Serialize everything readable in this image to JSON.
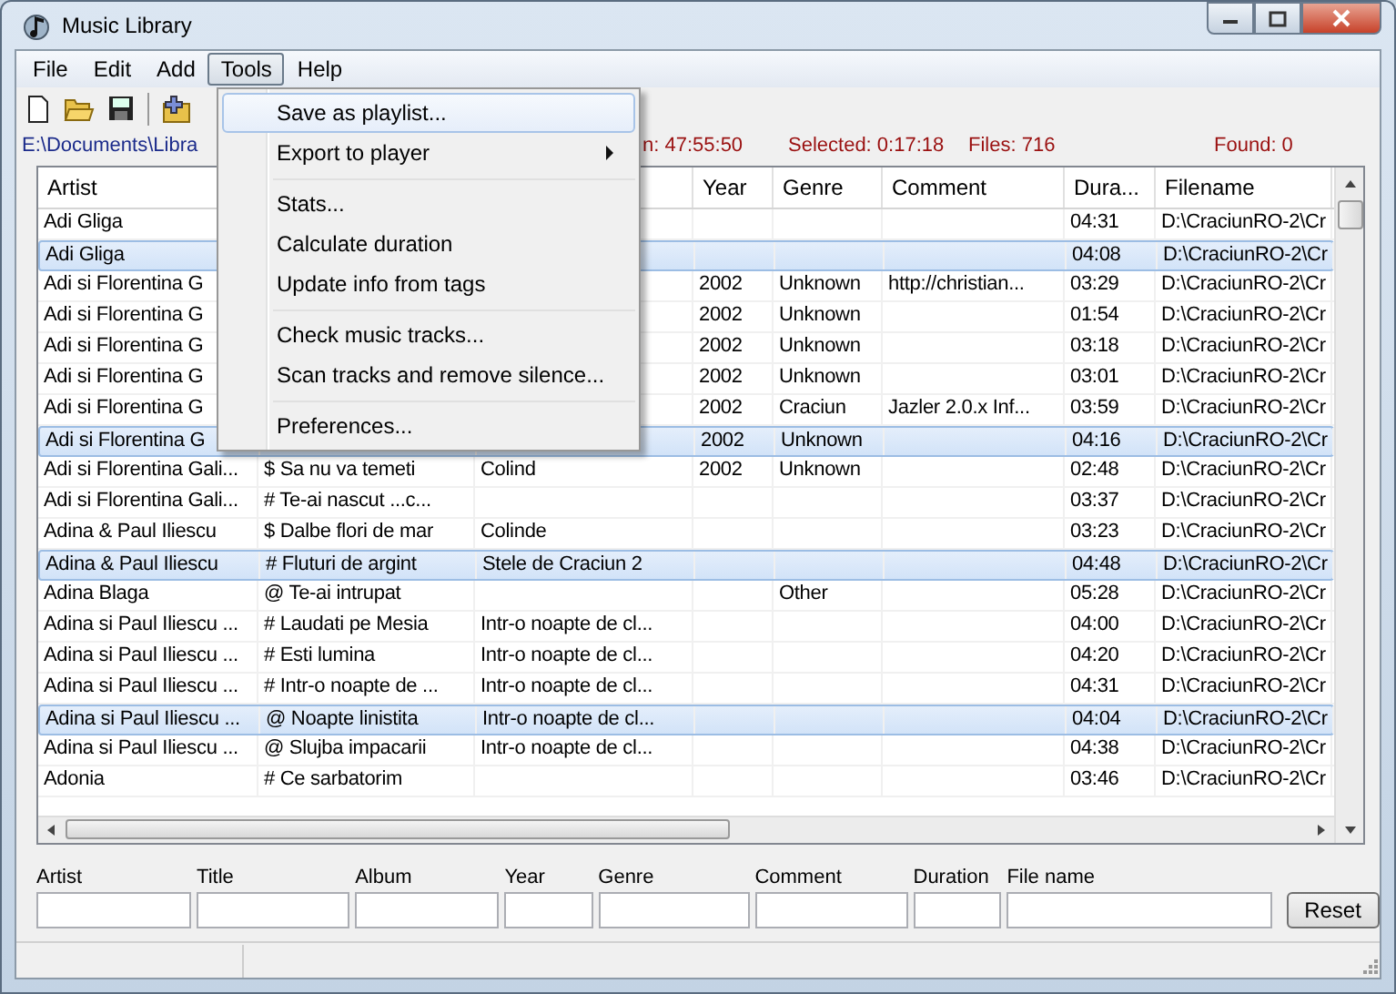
{
  "window": {
    "title": "Music Library"
  },
  "menubar": [
    {
      "label": "File",
      "selected": false
    },
    {
      "label": "Edit",
      "selected": false
    },
    {
      "label": "Add",
      "selected": false
    },
    {
      "label": "Tools",
      "selected": true
    },
    {
      "label": "Help",
      "selected": false
    }
  ],
  "menu": {
    "groups": [
      [
        {
          "label": "Save as playlist...",
          "selected": true,
          "submenu": false
        },
        {
          "label": "Export to player",
          "selected": false,
          "submenu": true
        }
      ],
      [
        {
          "label": "Stats...",
          "selected": false,
          "submenu": false
        },
        {
          "label": "Calculate duration",
          "selected": false,
          "submenu": false
        },
        {
          "label": "Update info from tags",
          "selected": false,
          "submenu": false
        }
      ],
      [
        {
          "label": "Check music tracks...",
          "selected": false,
          "submenu": false
        },
        {
          "label": "Scan tracks and remove silence...",
          "selected": false,
          "submenu": false
        }
      ],
      [
        {
          "label": "Preferences...",
          "selected": false,
          "submenu": false
        }
      ]
    ]
  },
  "info": {
    "path": "E:\\Documents\\Libra",
    "duration": "n: 47:55:50",
    "selected": "Selected: 0:17:18",
    "files": "Files: 716",
    "found": "Found: 0"
  },
  "table": {
    "columns": {
      "artist": "Artist",
      "year": "Year",
      "genre": "Genre",
      "comment": "Comment",
      "duration": "Dura...",
      "filename": "Filename"
    },
    "rows": [
      {
        "artist": "Adi Gliga",
        "duration": "04:31",
        "filename": "D:\\CraciunRO-2\\Cr",
        "selected": false
      },
      {
        "artist": "Adi Gliga",
        "duration": "04:08",
        "filename": "D:\\CraciunRO-2\\Cr",
        "selected": true
      },
      {
        "artist": "Adi si Florentina G",
        "year": "2002",
        "genre": "Unknown",
        "comment": "http://christian...",
        "duration": "03:29",
        "filename": "D:\\CraciunRO-2\\Cr",
        "selected": false
      },
      {
        "artist": "Adi si Florentina G",
        "year": "2002",
        "genre": "Unknown",
        "duration": "01:54",
        "filename": "D:\\CraciunRO-2\\Cr",
        "selected": false
      },
      {
        "artist": "Adi si Florentina G",
        "year": "2002",
        "genre": "Unknown",
        "duration": "03:18",
        "filename": "D:\\CraciunRO-2\\Cr",
        "selected": false
      },
      {
        "artist": "Adi si Florentina G",
        "year": "2002",
        "genre": "Unknown",
        "duration": "03:01",
        "filename": "D:\\CraciunRO-2\\Cr",
        "selected": false
      },
      {
        "artist": "Adi si Florentina G",
        "year": "2002",
        "genre": "Craciun",
        "comment": "Jazler 2.0.x Inf...",
        "duration": "03:59",
        "filename": "D:\\CraciunRO-2\\Cr",
        "selected": false
      },
      {
        "artist": "Adi si Florentina G",
        "year": "2002",
        "genre": "Unknown",
        "duration": "04:16",
        "filename": "D:\\CraciunRO-2\\Cr",
        "selected": true
      },
      {
        "artist": "Adi si Florentina Gali...",
        "title": "$ Sa nu va temeti",
        "album": "Colind",
        "year": "2002",
        "genre": "Unknown",
        "duration": "02:48",
        "filename": "D:\\CraciunRO-2\\Cr",
        "selected": false
      },
      {
        "artist": "Adi si Florentina Gali...",
        "title": "# Te-ai nascut ...c...",
        "duration": "03:37",
        "filename": "D:\\CraciunRO-2\\Cr",
        "selected": false
      },
      {
        "artist": "Adina & Paul Iliescu",
        "title": "$ Dalbe flori de mar",
        "album": "Colinde",
        "duration": "03:23",
        "filename": "D:\\CraciunRO-2\\Cr",
        "selected": false
      },
      {
        "artist": "Adina & Paul Iliescu",
        "title": "# Fluturi de argint",
        "album": "Stele de Craciun 2",
        "duration": "04:48",
        "filename": "D:\\CraciunRO-2\\Cr",
        "selected": true
      },
      {
        "artist": "Adina Blaga",
        "title": "@ Te-ai intrupat",
        "genre": "Other",
        "duration": "05:28",
        "filename": "D:\\CraciunRO-2\\Cr",
        "selected": false
      },
      {
        "artist": "Adina si Paul Iliescu ...",
        "title": "# Laudati pe Mesia",
        "album": "Intr-o noapte de cl...",
        "duration": "04:00",
        "filename": "D:\\CraciunRO-2\\Cr",
        "selected": false
      },
      {
        "artist": "Adina si Paul Iliescu ...",
        "title": "# Esti lumina",
        "album": "Intr-o noapte de cl...",
        "duration": "04:20",
        "filename": "D:\\CraciunRO-2\\Cr",
        "selected": false
      },
      {
        "artist": "Adina si Paul Iliescu ...",
        "title": "# Intr-o noapte de ...",
        "album": "Intr-o noapte de cl...",
        "duration": "04:31",
        "filename": "D:\\CraciunRO-2\\Cr",
        "selected": false
      },
      {
        "artist": "Adina si Paul Iliescu ...",
        "title": "@ Noapte linistita",
        "album": "Intr-o noapte de cl...",
        "duration": "04:04",
        "filename": "D:\\CraciunRO-2\\Cr",
        "selected": true
      },
      {
        "artist": "Adina si Paul Iliescu ...",
        "title": "@ Slujba impacarii",
        "album": "Intr-o noapte de cl...",
        "duration": "04:38",
        "filename": "D:\\CraciunRO-2\\Cr",
        "selected": false
      },
      {
        "artist": "Adonia",
        "title": "# Ce sarbatorim",
        "duration": "03:46",
        "filename": "D:\\CraciunRO-2\\Cr",
        "selected": false
      }
    ]
  },
  "filters": [
    {
      "label": "Artist"
    },
    {
      "label": "Title"
    },
    {
      "label": "Album"
    },
    {
      "label": "Year"
    },
    {
      "label": "Genre"
    },
    {
      "label": "Comment"
    },
    {
      "label": "Duration"
    },
    {
      "label": "File name"
    }
  ],
  "reset_button": "Reset"
}
